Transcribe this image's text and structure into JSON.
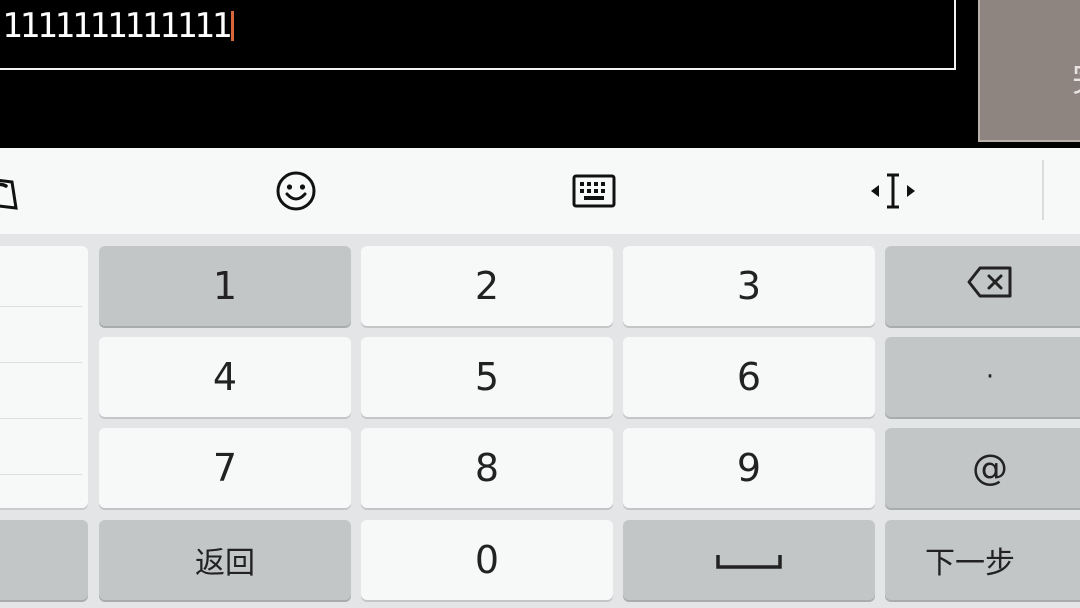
{
  "input": {
    "value": "1111111111111"
  },
  "done_button": {
    "label": "完"
  },
  "toolbar": {
    "icons": [
      "sogou-logo-icon",
      "emoji-icon",
      "keyboard-icon",
      "cursor-move-icon"
    ]
  },
  "keypad": {
    "row1": [
      "1",
      "2",
      "3"
    ],
    "row2": [
      "4",
      "5",
      "6"
    ],
    "row3": [
      "7",
      "8",
      "9"
    ],
    "row4_back": "返回",
    "row4_zero": "0",
    "dot": "·",
    "at": "@",
    "next": "下一步"
  },
  "colors": {
    "background": "#000000",
    "keyboard_bg": "#e3e5e6",
    "key_light": "#f7f9f8",
    "key_dark": "#c3c6c7",
    "cursor": "#d9663a"
  }
}
